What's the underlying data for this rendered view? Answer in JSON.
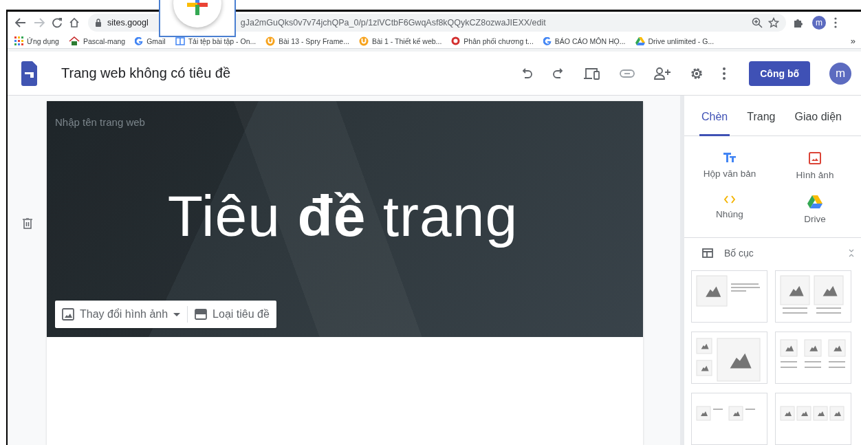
{
  "browser": {
    "url": {
      "host": "sites.googl",
      "path": "gJa2mGuQks0v7v74jchQPa_0/p/1zlVCtbF6GwqAsf8kQQykCZ8ozwaJIEXX/edit"
    },
    "avatar": "m",
    "bookmarks": [
      {
        "kind": "apps",
        "label": "Ứng dụng"
      },
      {
        "kind": "house",
        "label": "Pascal-mang"
      },
      {
        "kind": "google",
        "label": "Gmail"
      },
      {
        "kind": "doc",
        "label": "Tải tệp bài tập - On..."
      },
      {
        "kind": "moodle",
        "label": "Bài 13 - Spry Frame..."
      },
      {
        "kind": "moodle",
        "label": "Bài 1 - Thiết kế web..."
      },
      {
        "kind": "seal",
        "label": "Phân phối chương t..."
      },
      {
        "kind": "google",
        "label": "BÁO CÁO MÔN HỌ..."
      },
      {
        "kind": "drive",
        "label": "Drive unlimited - G..."
      }
    ],
    "more": "»"
  },
  "app": {
    "title": "Trang web không có tiêu đề",
    "publish": "Công bố",
    "avatar": "m"
  },
  "editor": {
    "site_name_placeholder": "Nhập tên trang web",
    "page_title": "Tiêu **đề** trang",
    "header_buttons": [
      {
        "kind": "image",
        "label": "Thay đổi hình ảnh"
      },
      {
        "kind": "title",
        "label": "Loại tiêu đề"
      }
    ]
  },
  "panel": {
    "tabs": [
      {
        "label": "Chèn",
        "selected": true
      },
      {
        "label": "Trang",
        "selected": false
      },
      {
        "label": "Giao diện",
        "selected": false
      }
    ],
    "insert_items": [
      {
        "kind": "text",
        "label": "Hộp văn bản"
      },
      {
        "kind": "image",
        "label": "Hình ảnh"
      },
      {
        "kind": "embed",
        "label": "Nhúng"
      },
      {
        "kind": "drive",
        "label": "Drive"
      }
    ],
    "layouts_label": "Bố cục"
  }
}
